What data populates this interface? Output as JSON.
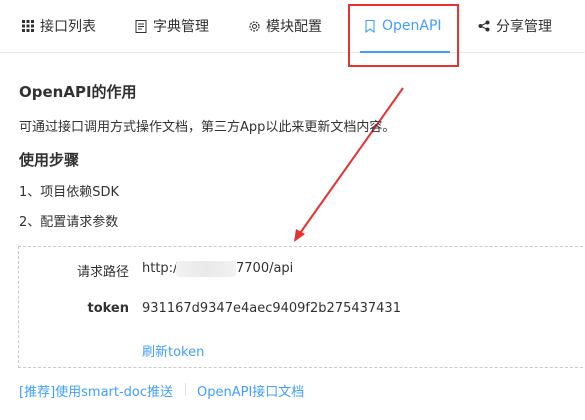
{
  "tabs": [
    {
      "label": "接口列表",
      "icon": "grid-icon"
    },
    {
      "label": "字典管理",
      "icon": "document-icon"
    },
    {
      "label": "模块配置",
      "icon": "gear-icon"
    },
    {
      "label": "OpenAPI",
      "icon": "bookmark-icon",
      "active": true
    },
    {
      "label": "分享管理",
      "icon": "share-icon"
    }
  ],
  "section1": {
    "title": "OpenAPI的作用",
    "desc": "可通过接口调用方式操作文档，第三方App以此来更新文档内容。"
  },
  "section2": {
    "title": "使用步骤",
    "steps": [
      "1、项目依赖SDK",
      "2、配置请求参数"
    ]
  },
  "config": {
    "url_label": "请求路径",
    "url_prefix": "http://",
    "url_suffix": "7700/api",
    "token_label": "token",
    "token_value": "931167d9347e4aec9409f2b275437431",
    "refresh_label": "刷新token"
  },
  "footer": {
    "link1": "[推荐]使用smart-doc推送",
    "link2": "OpenAPI接口文档"
  },
  "colors": {
    "accent": "#409eff",
    "annotation": "#e53333"
  }
}
